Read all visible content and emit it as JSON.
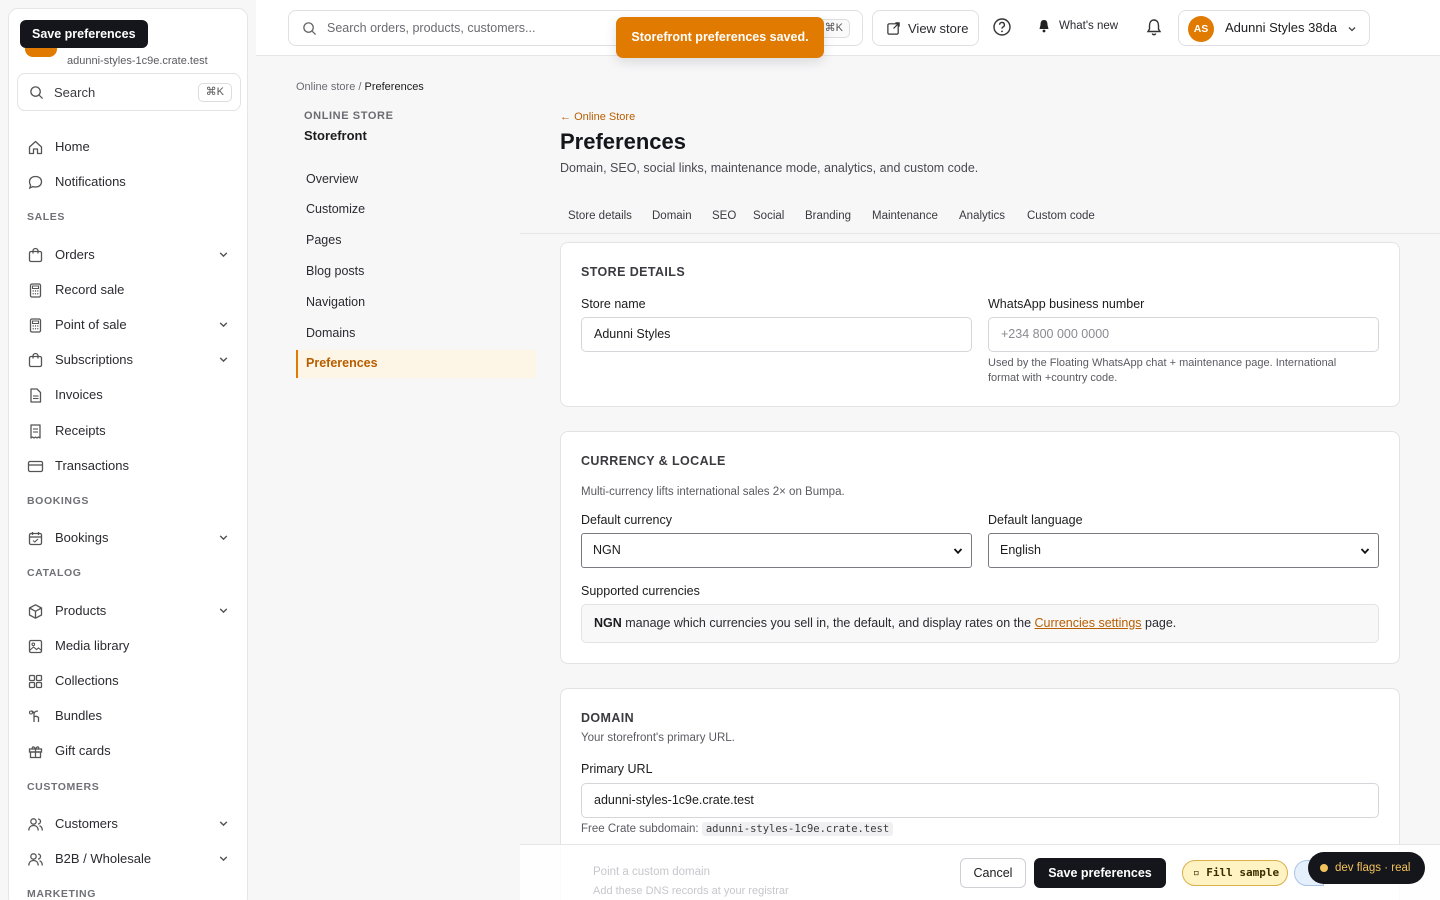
{
  "tooltip": "Save preferences",
  "sidebar": {
    "store_host": "adunni-styles-1c9e.crate.test",
    "search_label": "Search",
    "search_kbd": "⌘K",
    "items_top": [
      {
        "label": "Home",
        "icon": "home-icon"
      },
      {
        "label": "Notifications",
        "icon": "message-icon"
      }
    ],
    "section_sales": "SALES",
    "sales": [
      {
        "label": "Orders",
        "icon": "bag-icon",
        "expand": true
      },
      {
        "label": "Record sale",
        "icon": "calculator-icon",
        "expand": false
      },
      {
        "label": "Point of sale",
        "icon": "calculator-icon",
        "expand": true
      },
      {
        "label": "Subscriptions",
        "icon": "bag-icon",
        "expand": true
      },
      {
        "label": "Invoices",
        "icon": "document-icon",
        "expand": false
      },
      {
        "label": "Receipts",
        "icon": "receipt-icon",
        "expand": false
      },
      {
        "label": "Transactions",
        "icon": "card-icon",
        "expand": false
      }
    ],
    "section_bookings": "BOOKINGS",
    "bookings": [
      {
        "label": "Bookings",
        "icon": "calendar-icon",
        "expand": true
      }
    ],
    "section_catalog": "CATALOG",
    "catalog": [
      {
        "label": "Products",
        "icon": "box-icon",
        "expand": true
      },
      {
        "label": "Media library",
        "icon": "image-icon",
        "expand": false
      },
      {
        "label": "Collections",
        "icon": "grid-icon",
        "expand": false
      },
      {
        "label": "Bundles",
        "icon": "bundle-icon",
        "expand": false
      },
      {
        "label": "Gift cards",
        "icon": "gift-icon",
        "expand": false
      }
    ],
    "section_customers": "CUSTOMERS",
    "customers": [
      {
        "label": "Customers",
        "icon": "users-icon",
        "expand": true
      },
      {
        "label": "B2B / Wholesale",
        "icon": "users-icon",
        "expand": true
      }
    ],
    "section_marketing": "MARKETING"
  },
  "topbar": {
    "search_placeholder": "Search orders, products, customers...",
    "search_kbd": "⌘K",
    "view_store": "View store",
    "whats_new": "What's new",
    "account_initials": "AS",
    "account_name": "Adunni Styles 38da"
  },
  "toast": "Storefront preferences saved.",
  "breadcrumb": {
    "parent": "Online store",
    "sep": "/",
    "current": "Preferences"
  },
  "subnav": {
    "kicker": "ONLINE STORE",
    "title": "Storefront",
    "items": [
      {
        "label": "Overview",
        "active": false
      },
      {
        "label": "Customize",
        "active": false
      },
      {
        "label": "Pages",
        "active": false
      },
      {
        "label": "Blog posts",
        "active": false
      },
      {
        "label": "Navigation",
        "active": false
      },
      {
        "label": "Domains",
        "active": false
      },
      {
        "label": "Preferences",
        "active": true
      }
    ]
  },
  "header": {
    "back": "Online Store",
    "title": "Preferences",
    "subtitle": "Domain, SEO, social links, maintenance mode, analytics, and custom code."
  },
  "tabs": [
    "Store details",
    "Domain",
    "SEO",
    "Social",
    "Branding",
    "Maintenance",
    "Analytics",
    "Custom code"
  ],
  "store_details": {
    "title": "STORE DETAILS",
    "store_name_label": "Store name",
    "store_name_value": "Adunni Styles",
    "whatsapp_label": "WhatsApp business number",
    "whatsapp_placeholder": "+234 800 000 0000",
    "whatsapp_help_1": "Used by the Floating WhatsApp chat + maintenance page. International",
    "whatsapp_help_2": "format with +country code."
  },
  "currency": {
    "title": "CURRENCY & LOCALE",
    "note": "Multi-currency lifts international sales 2× on Bumpa.",
    "currency_label": "Default currency",
    "currency_value": "NGN",
    "language_label": "Default language",
    "language_value": "English",
    "supported_label": "Supported currencies",
    "supported_code": "NGN",
    "supported_text": " manage which currencies you sell in, the default, and display rates on the ",
    "supported_link": "Currencies settings",
    "supported_tail": " page."
  },
  "domain": {
    "title": "DOMAIN",
    "subtitle": "Your storefront's primary URL.",
    "url_label": "Primary URL",
    "url_value": "adunni-styles-1c9e.crate.test",
    "free_label": "Free Crate subdomain:",
    "free_value": "adunni-styles-1c9e.crate.test",
    "custom_title": "Point a custom domain",
    "custom_sub": "Add these DNS records at your registrar"
  },
  "actions": {
    "cancel": "Cancel",
    "save": "Save preferences",
    "fill": "▫ Fill sample",
    "devflags": "dev flags · real"
  },
  "colors": {
    "accent": "#e07a00",
    "dark": "#15161c"
  }
}
